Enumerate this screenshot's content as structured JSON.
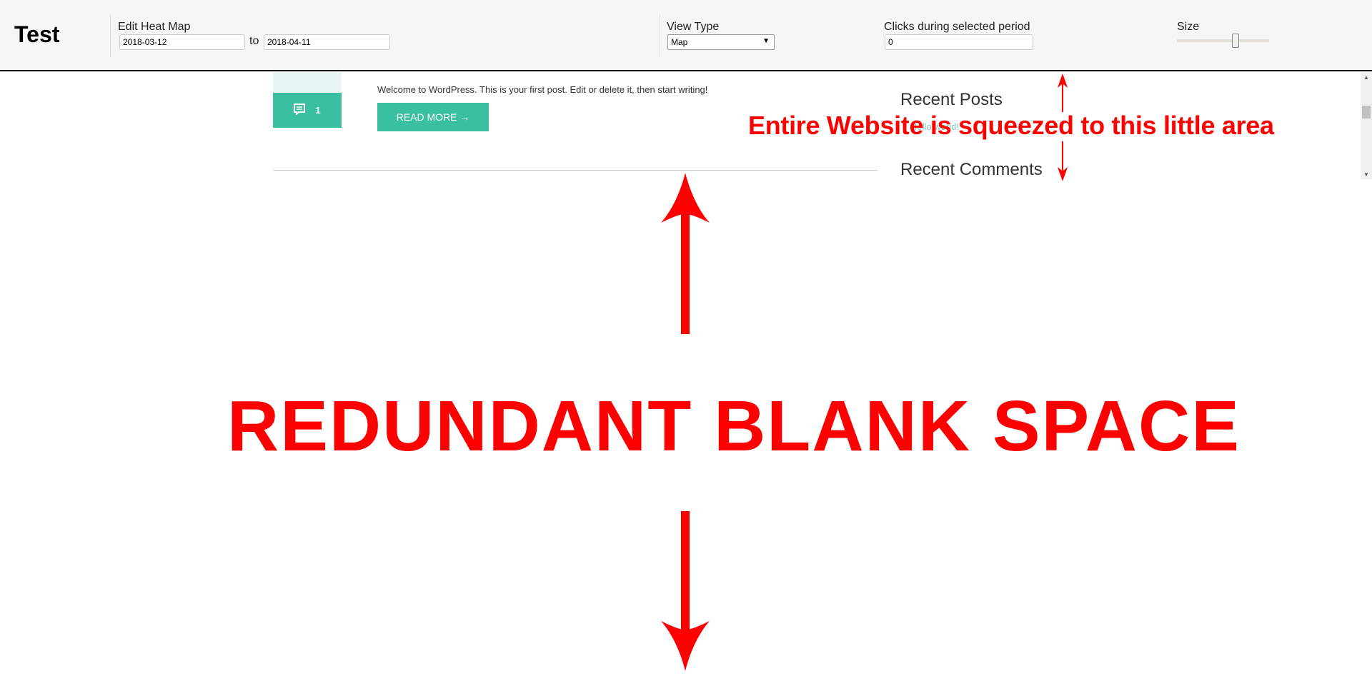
{
  "header": {
    "title": "Test",
    "edit_label": "Edit Heat Map",
    "date_from": "2018-03-12",
    "to_label": "to",
    "date_to": "2018-04-11",
    "view_type_label": "View Type",
    "view_type_value": "Map",
    "clicks_label": "Clicks during selected period",
    "clicks_value": "0",
    "size_label": "Size",
    "size_slider_percent": 65
  },
  "site": {
    "comment_count": "1",
    "excerpt": "Welcome to WordPress. This is your first post. Edit or delete it, then start writing!",
    "read_more": "READ MORE →",
    "recent_posts_title": "Recent Posts",
    "recent_post_link": "Hello world!",
    "recent_comments_title": "Recent Comments",
    "accent_color": "#3abfa0"
  },
  "annotations": {
    "squeezed": "Entire Website is squeezed to this little area",
    "blank": "REDUNDANT BLANK SPACE",
    "color": "#ff0000"
  }
}
